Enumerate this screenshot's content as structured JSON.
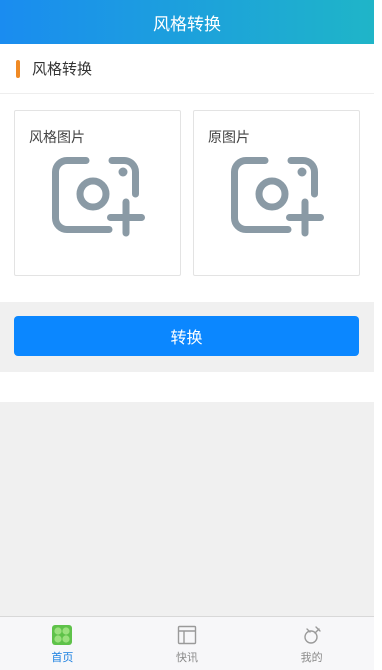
{
  "header": {
    "title": "风格转换"
  },
  "section": {
    "title": "风格转换"
  },
  "cards": [
    {
      "label": "风格图片",
      "icon": "add-photo-icon"
    },
    {
      "label": "原图片",
      "icon": "add-photo-icon"
    }
  ],
  "action": {
    "convert_label": "转换"
  },
  "tabbar": {
    "items": [
      {
        "label": "首页",
        "icon": "home-grid-icon",
        "active": true
      },
      {
        "label": "快讯",
        "icon": "news-layout-icon",
        "active": false
      },
      {
        "label": "我的",
        "icon": "profile-icon",
        "active": false
      }
    ]
  },
  "colors": {
    "header_gradient_start": "#1a8cf0",
    "header_gradient_end": "#1fb5c8",
    "accent_bar": "#f08a24",
    "primary_button": "#0b87ff",
    "active_tab": "#1a7fe0",
    "home_icon": "#5fc24a",
    "upload_icon": "#8a9aa5"
  }
}
